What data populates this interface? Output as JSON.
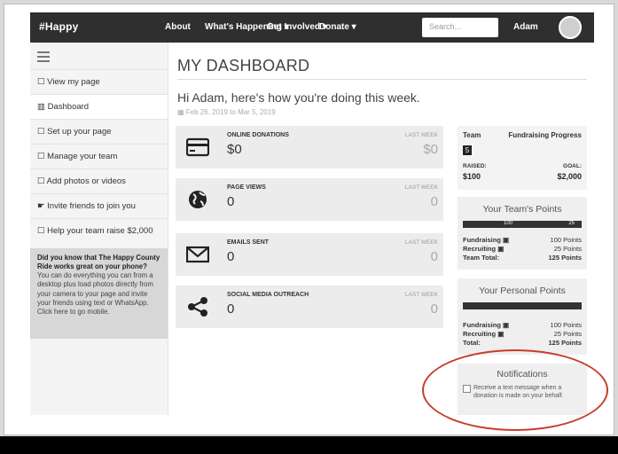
{
  "nav": {
    "brand": "#Happy",
    "links": [
      "About",
      "What's Happening ▾",
      "Get Involved ▾",
      "Donate ▾"
    ],
    "search_placeholder": "Search...",
    "user": "Adam"
  },
  "sidebar": {
    "items": [
      {
        "label": "☐ View my page"
      },
      {
        "label": "▥ Dashboard"
      },
      {
        "label": "☐ Set up your page"
      },
      {
        "label": "☐ Manage your team"
      },
      {
        "label": "☐ Add photos or videos"
      },
      {
        "label": "☛ Invite friends to join you"
      },
      {
        "label": "☐ Help your team raise $2,000"
      }
    ],
    "tip_bold": "Did you know that The Happy County Ride works great on your phone?",
    "tip_text": " You can do everything you can from a desktop plus load photos directly from your camera to your page and invite your friends using text or WhatsApp. Click here to go mobile."
  },
  "main": {
    "title": "MY DASHBOARD",
    "greeting": "Hi Adam, here's how you're doing this week.",
    "date_range": "Feb 26, 2019 to Mar 5, 2019"
  },
  "stats": [
    {
      "label": "ONLINE DONATIONS",
      "value": "$0",
      "last_week_label": "LAST WEEK",
      "last_week_value": "$0",
      "icon": "credit-card-icon"
    },
    {
      "label": "PAGE VIEWS",
      "value": "0",
      "last_week_label": "LAST WEEK",
      "last_week_value": "0",
      "icon": "globe-icon"
    },
    {
      "label": "EMAILS SENT",
      "value": "0",
      "last_week_label": "LAST WEEK",
      "last_week_value": "0",
      "icon": "envelope-icon"
    },
    {
      "label": "SOCIAL MEDIA OUTREACH",
      "value": "0",
      "last_week_label": "LAST WEEK",
      "last_week_value": "0",
      "icon": "share-icon"
    }
  ],
  "fundraising": {
    "team_label": "Team",
    "progress_label": "Fundraising Progress",
    "badge": "5",
    "raised_label": "RAISED:",
    "raised_value": "$100",
    "goal_label": "GOAL:",
    "goal_value": "$2,000"
  },
  "team_points": {
    "title": "Your Team's Points",
    "bar_left": "100",
    "bar_right": "25",
    "rows": [
      {
        "label": "Fundraising",
        "value": "100 Points"
      },
      {
        "label": "Recruiting",
        "value": "25 Points"
      },
      {
        "label": "Team Total:",
        "value": "125 Points"
      }
    ]
  },
  "personal_points": {
    "title": "Your Personal Points",
    "rows": [
      {
        "label": "Fundraising",
        "value": "100 Points"
      },
      {
        "label": "Recruiting",
        "value": "25 Points"
      },
      {
        "label": "Total:",
        "value": "125 Points"
      }
    ]
  },
  "notifications": {
    "title": "Notifications",
    "checkbox_label": "Receive a text message when a donation is made on your behalf."
  },
  "colors": {
    "nav_bg": "#2f2f2f",
    "annotation_red": "#c83c2d"
  }
}
